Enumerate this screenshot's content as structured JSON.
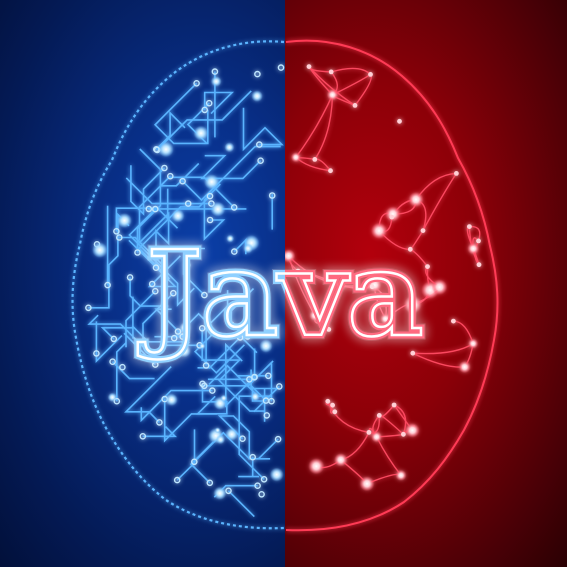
{
  "logo_text": "Java",
  "colors": {
    "left_circuit": "#5ab4ff",
    "left_glow": "#bfe6ff",
    "right_network": "#ff3a55",
    "right_glow": "#ffd0d6",
    "left_background": "#062a7a",
    "right_background": "#8a0008"
  },
  "description_icons": [
    "circuit-brain-left-hemisphere",
    "neural-network-brain-right-hemisphere"
  ]
}
